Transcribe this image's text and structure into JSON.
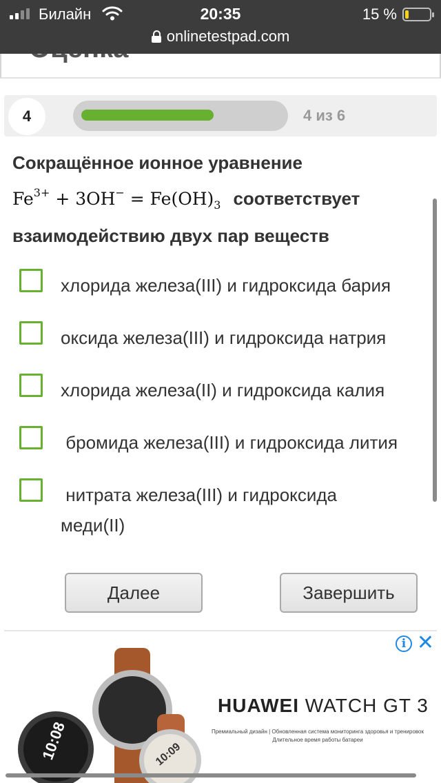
{
  "status_bar": {
    "carrier": "Билайн",
    "time": "20:35",
    "battery": "15 %",
    "battery_level": 0.15
  },
  "url_bar": {
    "url": "onlinetestpad.com"
  },
  "previous_section_fragment": "Оценка",
  "question_header": {
    "number": "4",
    "progress_label": "4 из 6",
    "progress_fraction": 0.667
  },
  "question": {
    "intro": "Сокращённое ионное уравнение",
    "equation": {
      "fe": "Fe",
      "fe_charge": "3+",
      "plus": " + ",
      "oh": "3OH",
      "oh_charge": "−",
      "equals": " = ",
      "product": "Fe(OH)",
      "product_index": "3"
    },
    "continuation": "соответствует взаимодействию двух пар веществ"
  },
  "options": [
    {
      "label": "хлорида железа(III) и гидроксида бария",
      "checked": false
    },
    {
      "label": "оксида железа(III) и гидроксида натрия",
      "checked": false
    },
    {
      "label": "хлорида железа(II) и гидроксида калия",
      "checked": false
    },
    {
      "label": " бромида железа(III) и гидроксида лития",
      "checked": false
    },
    {
      "label": " нитрата железа(III) и гидроксида меди(II)",
      "checked": false
    }
  ],
  "buttons": {
    "next": "Далее",
    "finish": "Завершить"
  },
  "ad": {
    "brand_bold": "HUAWEI",
    "brand_rest": " WATCH GT 3",
    "subtitle_line1": "Премиальный дизайн | Обновленная система мониторинга здоровья и тренировок",
    "subtitle_line2": "Длительное время работы батареи",
    "watch_face_1": "10:08",
    "watch_face_2": "10:09",
    "colors": {
      "accent": "#1e88e5"
    }
  },
  "colors": {
    "checkbox_border": "#67b030",
    "progress_fill": "#67b030",
    "status_bar_bg": "#3c3c3c"
  }
}
